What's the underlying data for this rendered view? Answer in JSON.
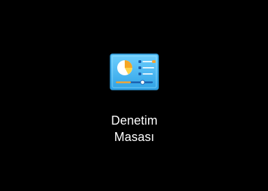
{
  "desktop": {
    "background_color": "#000000",
    "icon": {
      "name": "control-panel-icon",
      "label_line1": "Denetim",
      "label_line2": "Masası",
      "colors": {
        "panel": "#3fb7ee",
        "panel_edge": "#2a95d6",
        "pie_orange": "#f5a623",
        "pie_yellow": "#ffd34a",
        "pie_white": "#ffffff",
        "slider": "#1a5fae",
        "accent": "#f2a533"
      }
    }
  }
}
